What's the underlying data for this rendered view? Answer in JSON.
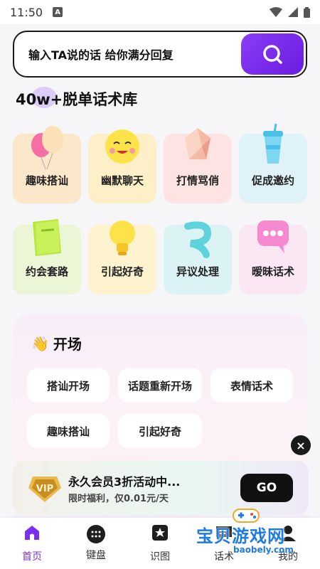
{
  "status": {
    "time": "11:50",
    "notif_glyph": "A"
  },
  "search": {
    "prompt": "输入TA说的话 给你满分回复"
  },
  "library": {
    "title": "40w+脱单话术库"
  },
  "categories": [
    {
      "label": "趣味搭讪",
      "icon": "balloons-icon",
      "bg": "#fbe7c9"
    },
    {
      "label": "幽默聊天",
      "icon": "laughing-face-icon",
      "bg": "#fdf0c8"
    },
    {
      "label": "打情骂俏",
      "icon": "crystal-icon",
      "bg": "#fde3e1"
    },
    {
      "label": "促成邀约",
      "icon": "cup-icon",
      "bg": "#dff2f7"
    },
    {
      "label": "约会套路",
      "icon": "book-icon",
      "bg": "#eaf6d6"
    },
    {
      "label": "引起好奇",
      "icon": "lightbulb-icon",
      "bg": "#fdf4cf"
    },
    {
      "label": "异议处理",
      "icon": "swirl-icon",
      "bg": "#dcf3f5"
    },
    {
      "label": "暧昧话术",
      "icon": "chat-bubble-icon",
      "bg": "#fbe6f4"
    }
  ],
  "opening": {
    "emoji": "👋",
    "title": "开场",
    "chips": [
      "搭讪开场",
      "话题重新开场",
      "表情话术",
      "趣味搭讪",
      "引起好奇"
    ]
  },
  "promo": {
    "badge": "VIP",
    "title": "永久会员3折活动中...",
    "subtitle": "限时福利，仅0.01元/天",
    "go_label": "GO"
  },
  "close_glyph": "×",
  "tabs": [
    {
      "label": "首页",
      "icon": "home-icon",
      "active": true
    },
    {
      "label": "键盘",
      "icon": "keyboard-icon",
      "active": false
    },
    {
      "label": "识图",
      "icon": "image-star-icon",
      "active": false
    },
    {
      "label": "话术",
      "icon": "chat-icon",
      "active": false
    },
    {
      "label": "我的",
      "icon": "profile-icon",
      "active": false
    }
  ],
  "watermark": {
    "text": "宝贝游戏网",
    "url": "baobely.com"
  },
  "colors": {
    "accent": "#7a2ff0",
    "dark": "#111111"
  }
}
